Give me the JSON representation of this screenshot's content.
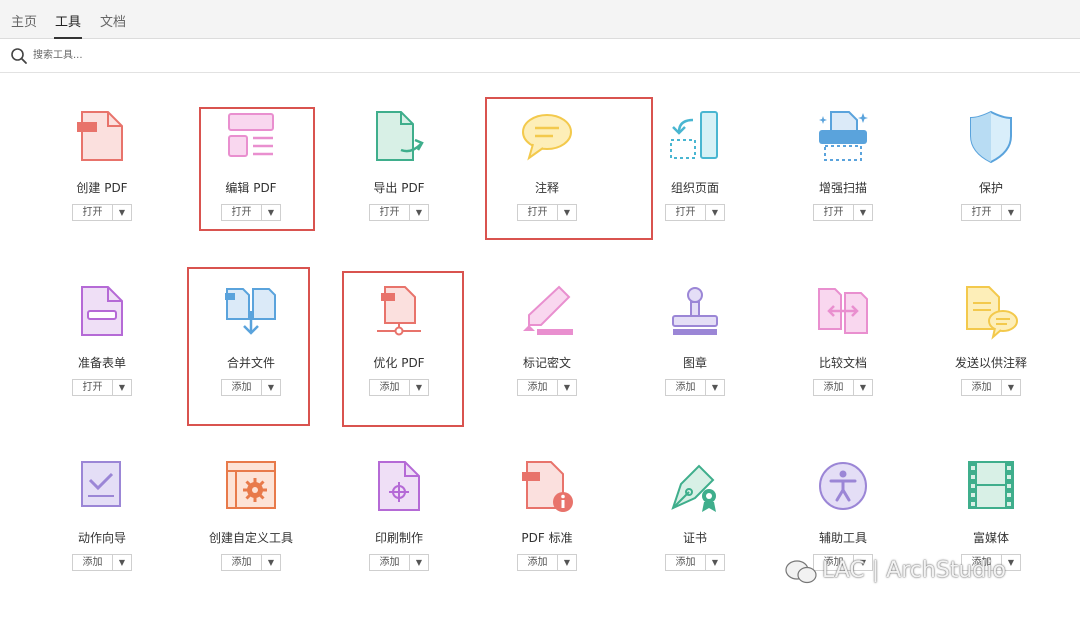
{
  "tabs": [
    {
      "label": "主页"
    },
    {
      "label": "工具"
    },
    {
      "label": "文档"
    }
  ],
  "search": {
    "placeholder": "搜索工具..."
  },
  "tools": [
    {
      "label": "创建 PDF",
      "action": "打开",
      "icon": "create-pdf-icon"
    },
    {
      "label": "编辑 PDF",
      "action": "打开",
      "icon": "edit-pdf-icon"
    },
    {
      "label": "导出 PDF",
      "action": "打开",
      "icon": "export-pdf-icon"
    },
    {
      "label": "注释",
      "action": "打开",
      "icon": "comment-icon"
    },
    {
      "label": "组织页面",
      "action": "打开",
      "icon": "organize-pages-icon"
    },
    {
      "label": "增强扫描",
      "action": "打开",
      "icon": "enhance-scan-icon"
    },
    {
      "label": "保护",
      "action": "打开",
      "icon": "protect-icon"
    },
    {
      "label": "准备表单",
      "action": "打开",
      "icon": "prepare-form-icon"
    },
    {
      "label": "合并文件",
      "action": "添加",
      "icon": "combine-files-icon"
    },
    {
      "label": "优化 PDF",
      "action": "添加",
      "icon": "optimize-pdf-icon"
    },
    {
      "label": "标记密文",
      "action": "添加",
      "icon": "redact-icon"
    },
    {
      "label": "图章",
      "action": "添加",
      "icon": "stamp-icon"
    },
    {
      "label": "比较文档",
      "action": "添加",
      "icon": "compare-icon"
    },
    {
      "label": "发送以供注释",
      "action": "添加",
      "icon": "send-for-comments-icon"
    },
    {
      "label": "动作向导",
      "action": "添加",
      "icon": "action-wizard-icon"
    },
    {
      "label": "创建自定义工具",
      "action": "添加",
      "icon": "custom-tool-icon"
    },
    {
      "label": "印刷制作",
      "action": "添加",
      "icon": "print-production-icon"
    },
    {
      "label": "PDF 标准",
      "action": "添加",
      "icon": "pdf-standards-icon"
    },
    {
      "label": "证书",
      "action": "添加",
      "icon": "certificates-icon"
    },
    {
      "label": "辅助工具",
      "action": "添加",
      "icon": "accessibility-icon"
    },
    {
      "label": "富媒体",
      "action": "添加",
      "icon": "rich-media-icon"
    }
  ],
  "colors": {
    "highlight": "#d9534f",
    "red": "#e8736b",
    "pink": "#e98fcf",
    "green": "#3fae8c",
    "yellow": "#f3c94c",
    "teal": "#49b6d1",
    "blue": "#5aa3dc",
    "purple": "#9b86d6"
  },
  "watermark": {
    "text": "LAC | ArchStudio"
  }
}
